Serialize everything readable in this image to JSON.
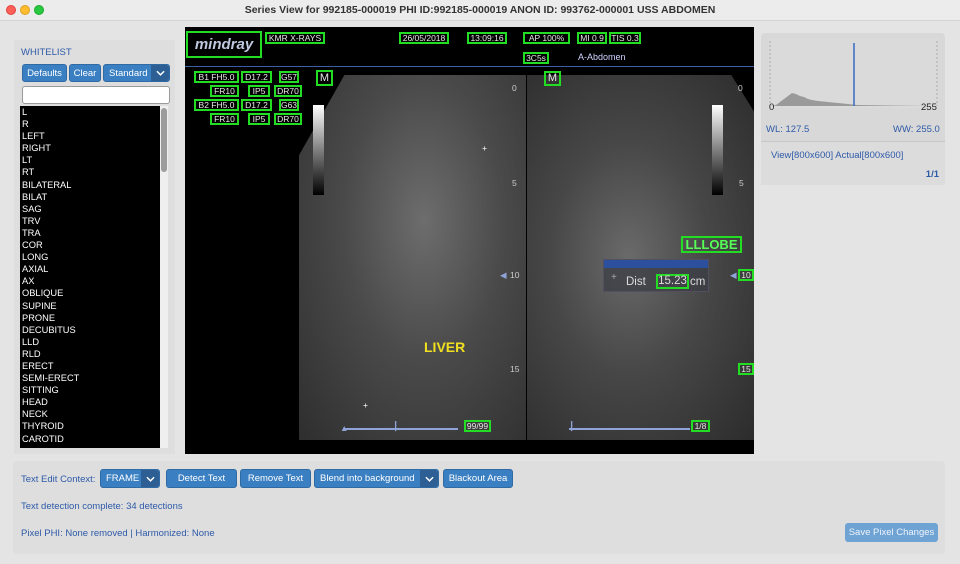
{
  "window": {
    "title": "Series View for 992185-000019 PHI ID:992185-000019 ANON ID: 993762-000001 USS ABDOMEN"
  },
  "sidebar": {
    "title": "WHITELIST",
    "defaults_label": "Defaults",
    "clear_label": "Clear",
    "preset_value": "Standard",
    "filter_value": "",
    "items": [
      "L",
      "R",
      "LEFT",
      "RIGHT",
      "LT",
      "RT",
      "BILATERAL",
      "BILAT",
      "SAG",
      "TRV",
      "TRA",
      "COR",
      "LONG",
      "AXIAL",
      "AX",
      "OBLIQUE",
      "SUPINE",
      "PRONE",
      "DECUBITUS",
      "LLD",
      "RLD",
      "ERECT",
      "SEMI-ERECT",
      "SITTING",
      "HEAD",
      "NECK",
      "THYROID",
      "CAROTID"
    ]
  },
  "viewer": {
    "logo": "mindray",
    "institution": "KMR X-RAYS",
    "date": "26/05/2018",
    "time": "13:09:16",
    "ap": "AP 100%",
    "mi": "MI 0.9",
    "tis": "TIS 0.3",
    "probe": "3C5s",
    "preset": "A-Abdomen",
    "b1_label": "B1 FH5.0",
    "b1_d": "D17.2",
    "b1_g": "G57",
    "b1_fr": "FR10",
    "b1_ip": "IP5",
    "b1_dr": "DR70",
    "b2_label": "B2 FH5.0",
    "b2_d": "D17.2",
    "b2_g": "G63",
    "b2_fr": "FR10",
    "b2_ip": "IP5",
    "b2_dr": "DR70",
    "marker_m1": "M",
    "marker_m2": "M",
    "depth_ticks": [
      "0",
      "5",
      "10",
      "15"
    ],
    "depth_ticks_right": [
      "0",
      "5",
      "10",
      "15"
    ],
    "organ_label": "LIVER",
    "lobe_label": "LLLOBE",
    "dist_label": "Dist",
    "dist_value": "15.23",
    "dist_unit": "cm",
    "frame_left": "99/99",
    "frame_right": "1/8"
  },
  "histogram": {
    "min_label": "0",
    "max_label": "255",
    "wl": "WL: 127.5",
    "ww": "WW: 255.0",
    "view_info": "View[800x600] Actual[800x600]",
    "page": "1/1"
  },
  "bottom": {
    "context_label": "Text Edit Context:",
    "context_value": "FRAME",
    "detect_label": "Detect Text",
    "remove_label": "Remove Text",
    "blend_value": "Blend into background",
    "blackout_label": "Blackout Area",
    "status": "Text detection complete: 34 detections",
    "pixel_phi": "Pixel PHI: None removed | Harmonized: None",
    "save_label": "Save Pixel Changes"
  },
  "colors": {
    "accent": "#3a7fc1",
    "detection_box": "#22dd22",
    "link_text": "#2e5aa8",
    "organ_label": "#f0e020"
  }
}
